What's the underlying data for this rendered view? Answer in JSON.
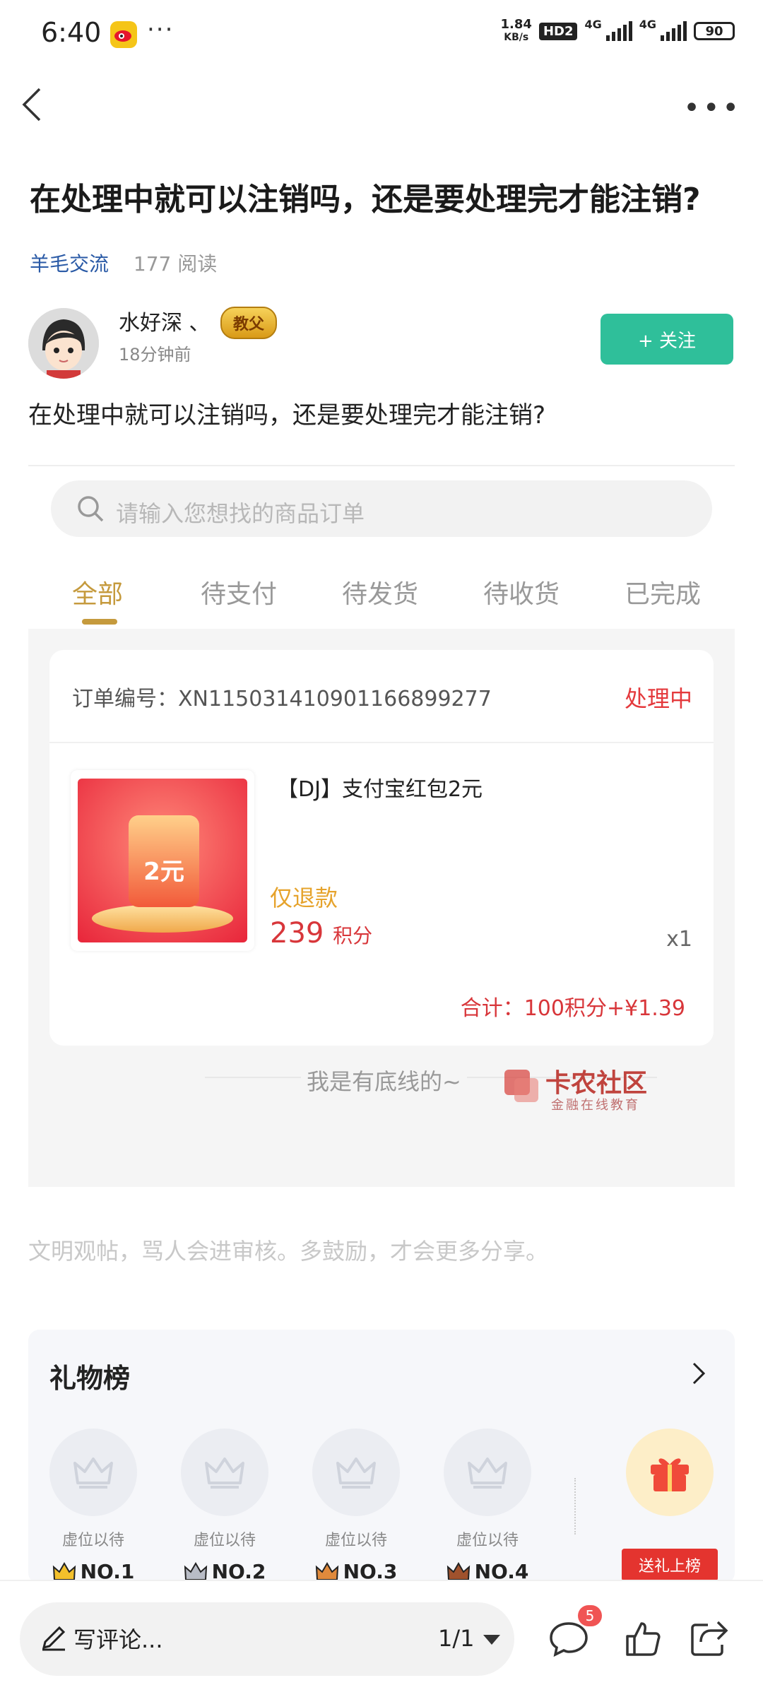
{
  "status_bar": {
    "time": "6:40",
    "dots": "···",
    "net_speed_value": "1.84",
    "net_speed_unit": "KB/s",
    "hd": "HD2",
    "net1": "4G",
    "net2": "4G",
    "battery": "90"
  },
  "nav": {
    "more": "•••"
  },
  "post": {
    "title": "在处理中就可以注销吗，还是要处理完才能注销?",
    "category": "羊毛交流",
    "reads": "177 阅读",
    "author": "水好深 、",
    "author_badge": "教父",
    "time_ago": "18分钟前",
    "follow_label": "+ 关注",
    "body": "在处理中就可以注销吗，还是要处理完才能注销?"
  },
  "screenshot": {
    "search_placeholder": "请输入您想找的商品订单",
    "tabs": [
      "全部",
      "待支付",
      "待发货",
      "待收货",
      "已完成"
    ],
    "order_no": "订单编号：XN11503141090116689927​7",
    "order_status": "处理中",
    "product_name": "【DJ】支付宝红包2元",
    "thumb_text": "2元",
    "refund_label": "仅退款",
    "price_value": "239",
    "price_unit": "积分",
    "qty": "x1",
    "total": "合计：100积分+¥1.39",
    "bottom_text": "我是有底线的~",
    "watermark": "卡农社区",
    "watermark_sub": "金融在线教育"
  },
  "civility_note": "文明观帖，骂人会进审核。多鼓励，才会更多分享。",
  "gift_board": {
    "title": "礼物榜",
    "slots": [
      {
        "label": "虚位以待",
        "rank": "NO.1",
        "crown_color": "#f3c02b"
      },
      {
        "label": "虚位以待",
        "rank": "NO.2",
        "crown_color": "#b8bcc6"
      },
      {
        "label": "虚位以待",
        "rank": "NO.3",
        "crown_color": "#e08a3c"
      },
      {
        "label": "虚位以待",
        "rank": "NO.4",
        "crown_color": "#a0522d"
      }
    ],
    "send_label": "送礼上榜"
  },
  "bottom_bar": {
    "comment_placeholder": "写评论...",
    "pager": "1/1",
    "comment_count": "5"
  }
}
